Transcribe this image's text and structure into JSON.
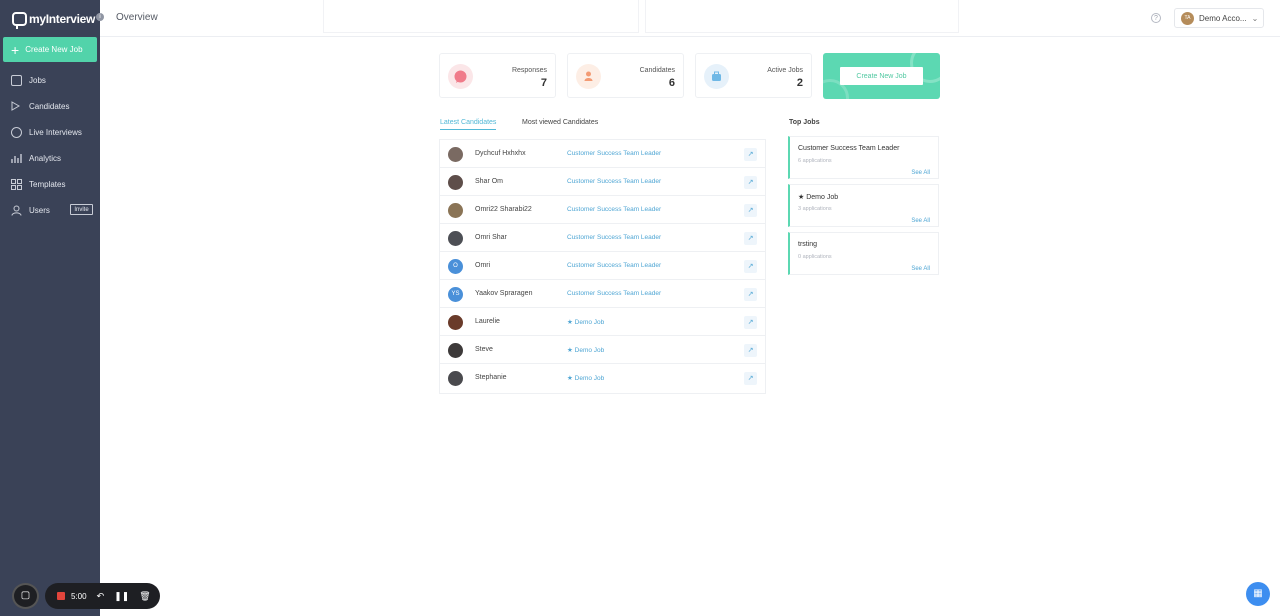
{
  "app": {
    "logo_text": "myInterview"
  },
  "sidebar": {
    "create_label": "Create New Job",
    "items": [
      {
        "label": "Jobs",
        "icon": "briefcase-icon"
      },
      {
        "label": "Candidates",
        "icon": "play-icon"
      },
      {
        "label": "Live Interviews",
        "icon": "headset-icon"
      },
      {
        "label": "Analytics",
        "icon": "bar-chart-icon"
      },
      {
        "label": "Templates",
        "icon": "grid-icon"
      },
      {
        "label": "Users",
        "icon": "users-icon"
      }
    ],
    "invite_label": "Invite"
  },
  "header": {
    "title": "Overview",
    "account_name": "Demo Acco...",
    "account_initials": "TA"
  },
  "stats": [
    {
      "label": "Responses",
      "value": "7",
      "color": "#f4d3d6"
    },
    {
      "label": "Candidates",
      "value": "6",
      "color": "#fde4d6"
    },
    {
      "label": "Active Jobs",
      "value": "2",
      "color": "#dcecf8"
    }
  ],
  "create_card": {
    "button_label": "Create New Job"
  },
  "tabs": {
    "latest": "Latest Candidates",
    "most_viewed": "Most viewed Candidates"
  },
  "candidates": [
    {
      "name": "Dychcuf Hxhxhx",
      "job": "Customer Success Team Leader",
      "avatar": ""
    },
    {
      "name": "Shar Om",
      "job": "Customer Success Team Leader",
      "avatar": ""
    },
    {
      "name": "Omri22 Sharabi22",
      "job": "Customer Success Team Leader",
      "avatar": ""
    },
    {
      "name": "Omri Shar",
      "job": "Customer Success Team Leader",
      "avatar": ""
    },
    {
      "name": "Omri",
      "job": "Customer Success Team Leader",
      "avatar": "O"
    },
    {
      "name": "Yaakov Spraragen",
      "job": "Customer Success Team Leader",
      "avatar": "YS"
    },
    {
      "name": "Laurelie",
      "job": "★ Demo Job",
      "avatar": ""
    },
    {
      "name": "Steve",
      "job": "★ Demo Job",
      "avatar": ""
    },
    {
      "name": "Stephanie",
      "job": "★ Demo Job",
      "avatar": ""
    }
  ],
  "top_jobs": {
    "title": "Top Jobs",
    "see_all": "See All",
    "jobs": [
      {
        "title": "Customer Success Team Leader",
        "applications": "6 applications"
      },
      {
        "title": "★ Demo Job",
        "applications": "3 applications"
      },
      {
        "title": "trsting",
        "applications": "0 applications"
      }
    ]
  },
  "recorder": {
    "time": "5:00"
  }
}
